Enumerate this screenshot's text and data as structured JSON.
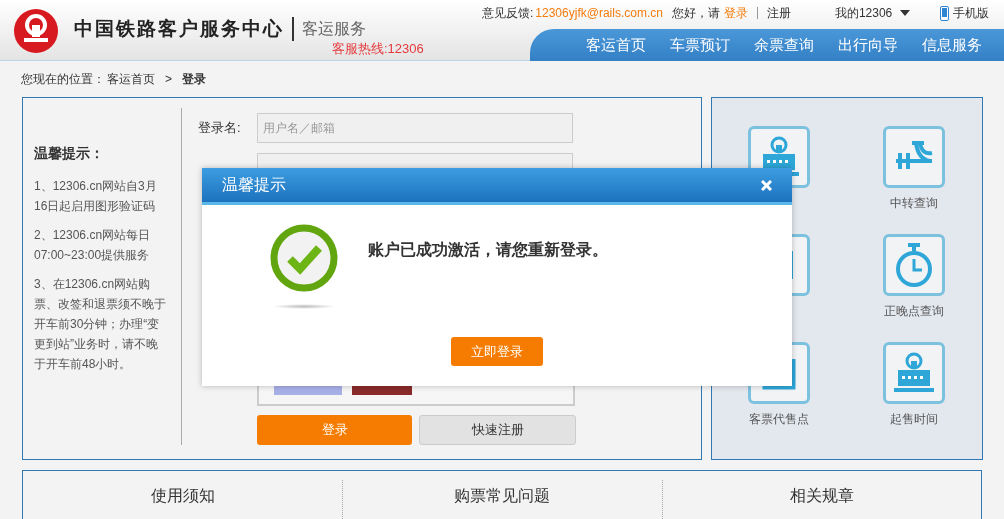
{
  "header": {
    "site_title": "中国铁路客户服务中心",
    "subtitle": "客运服务",
    "hotline": "客服热线:12306",
    "feedback_label": "意见反馈:",
    "feedback_email": "12306yjfk@rails.com.cn",
    "greeting": "您好，请",
    "login_link": "登录",
    "register_link": "注册",
    "my_account": "我的12306",
    "mobile": "手机版"
  },
  "nav": [
    {
      "label": "客运首页"
    },
    {
      "label": "车票预订"
    },
    {
      "label": "余票查询"
    },
    {
      "label": "出行向导"
    },
    {
      "label": "信息服务"
    }
  ],
  "breadcrumb": {
    "prefix": "您现在的位置：",
    "home": "客运首页",
    "separator": ">",
    "current": "登录"
  },
  "tips": {
    "title": "温馨提示：",
    "items": [
      "1、12306.cn网站自3月16日起启用图形验证码",
      "2、12306.cn网站每日07:00~23:00提供服务",
      "3、在12306.cn网站购票、改签和退票须不晚于开车前30分钟；办理“变更到站”业务时，请不晚于开车前48小时。"
    ]
  },
  "login_form": {
    "username_label": "登录名:",
    "username_placeholder": "用户名／邮箱",
    "login_button": "登录",
    "register_button": "快速注册"
  },
  "quick_links": [
    {
      "kind": "station"
    },
    {
      "kind": "transfer",
      "label": "中转查询"
    },
    {
      "kind": "ticket"
    },
    {
      "kind": "clock",
      "label": "正晚点查询"
    },
    {
      "kind": "agency",
      "label": "客票代售点"
    },
    {
      "kind": "station",
      "label": "起售时间"
    }
  ],
  "bottom_tabs": [
    {
      "label": "使用须知"
    },
    {
      "label": "购票常见问题"
    },
    {
      "label": "相关规章"
    }
  ],
  "dialog": {
    "title": "温馨提示",
    "message": "账户已成功激活，请您重新登录。",
    "button": "立即登录"
  }
}
